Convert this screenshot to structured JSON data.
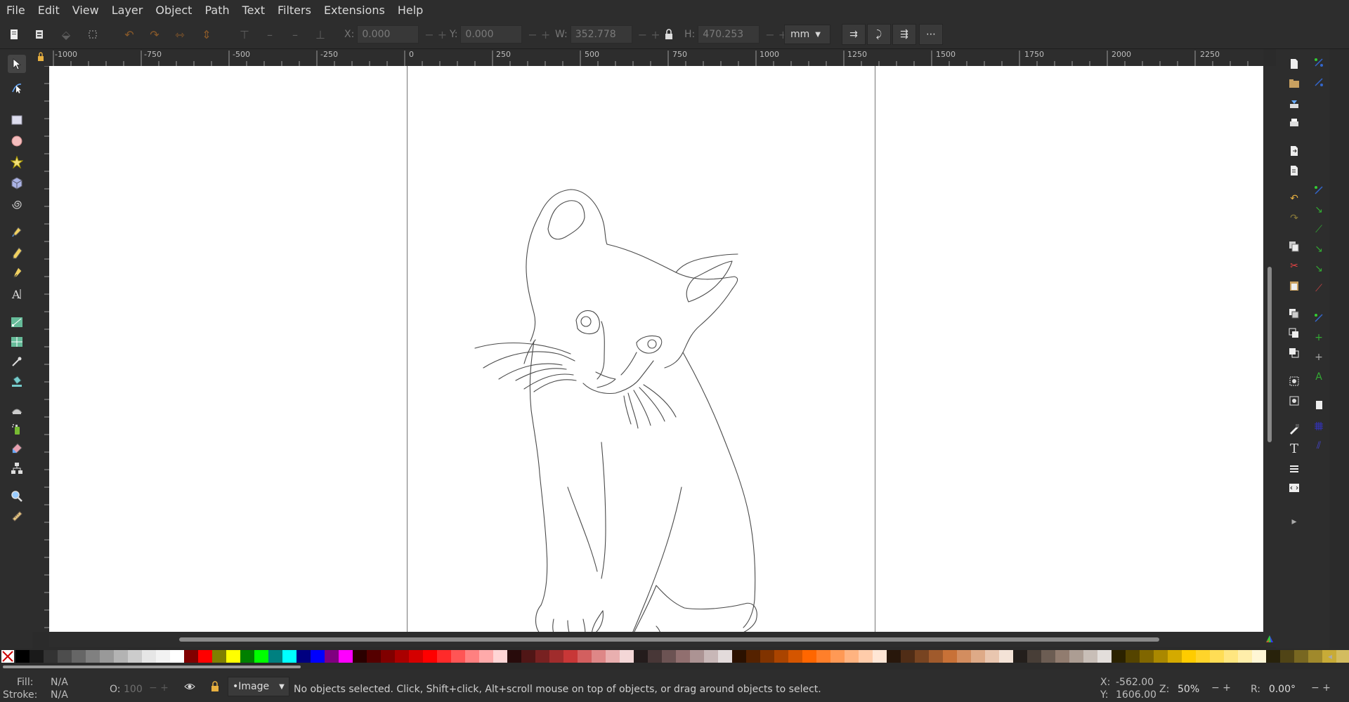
{
  "menubar": {
    "items": [
      "File",
      "Edit",
      "View",
      "Layer",
      "Object",
      "Path",
      "Text",
      "Filters",
      "Extensions",
      "Help"
    ]
  },
  "tool_controls": {
    "x": {
      "label": "X:",
      "value": "0.000"
    },
    "y": {
      "label": "Y:",
      "value": "0.000"
    },
    "w": {
      "label": "W:",
      "value": "352.778"
    },
    "h": {
      "label": "H:",
      "value": "470.253"
    },
    "unit": "mm"
  },
  "ruler": {
    "top_labels": [
      "-1000",
      "-750",
      "-500",
      "-250",
      "0",
      "250",
      "500",
      "750",
      "1000",
      "1250",
      "1500",
      "1750",
      "2000",
      "2250"
    ]
  },
  "status": {
    "fill_label": "Fill:",
    "fill_value": "N/A",
    "stroke_label": "Stroke:",
    "stroke_value": "N/A",
    "opacity_label": "O:",
    "opacity_value": "100",
    "layer": "•Image",
    "message": "No objects selected. Click, Shift+click, Alt+scroll mouse on top of objects, or drag around objects to select.",
    "cursor_x_label": "X:",
    "cursor_x": "-562.00",
    "cursor_y_label": "Y:",
    "cursor_y": "1606.00",
    "zoom_label": "Z:",
    "zoom": "50%",
    "rotate_label": "R:",
    "rotate": "0.00°"
  },
  "canvas": {
    "drawing": "cat-line-art"
  },
  "palette": {
    "colors": [
      "#000000",
      "#1a1a1a",
      "#333333",
      "#4d4d4d",
      "#666666",
      "#808080",
      "#999999",
      "#b3b3b3",
      "#cccccc",
      "#e6e6e6",
      "#f2f2f2",
      "#ffffff",
      "#800000",
      "#ff0000",
      "#808000",
      "#ffff00",
      "#008000",
      "#00ff00",
      "#008080",
      "#00ffff",
      "#000080",
      "#0000ff",
      "#800080",
      "#ff00ff",
      "#2b0000",
      "#550000",
      "#800000",
      "#aa0000",
      "#d40000",
      "#ff0000",
      "#ff2a2a",
      "#ff5555",
      "#ff8080",
      "#ffaaaa",
      "#ffd5d5",
      "#280b0b",
      "#501616",
      "#782121",
      "#a02c2c",
      "#c83737",
      "#d35f5f",
      "#de8787",
      "#e9afaf",
      "#f4d7d7",
      "#241c1c",
      "#483737",
      "#6c5353",
      "#916f6f",
      "#ac9393",
      "#c8b7b7",
      "#e3dbdb",
      "#2b1100",
      "#552200",
      "#803300",
      "#aa4400",
      "#d45500",
      "#ff6600",
      "#ff7f2a",
      "#ff9955",
      "#ffb380",
      "#ffccaa",
      "#ffe6d5",
      "#28170b",
      "#502d16",
      "#784421",
      "#a05a2c",
      "#c87137",
      "#d38d5f",
      "#deaa87",
      "#e9c6af",
      "#f4e3d7",
      "#241f1c",
      "#483e37",
      "#6c5d53",
      "#917c6f",
      "#ac9d93",
      "#c8beb7",
      "#e3dedb",
      "#2b2200",
      "#554400",
      "#806600",
      "#aa8800",
      "#d4aa00",
      "#ffcc00",
      "#ffd42a",
      "#ffdd55",
      "#ffe680",
      "#ffeeaa",
      "#fff6d5",
      "#28220b",
      "#504416",
      "#786721",
      "#a0892c",
      "#c8ab37",
      "#d3bc5f",
      "#decd87"
    ]
  }
}
